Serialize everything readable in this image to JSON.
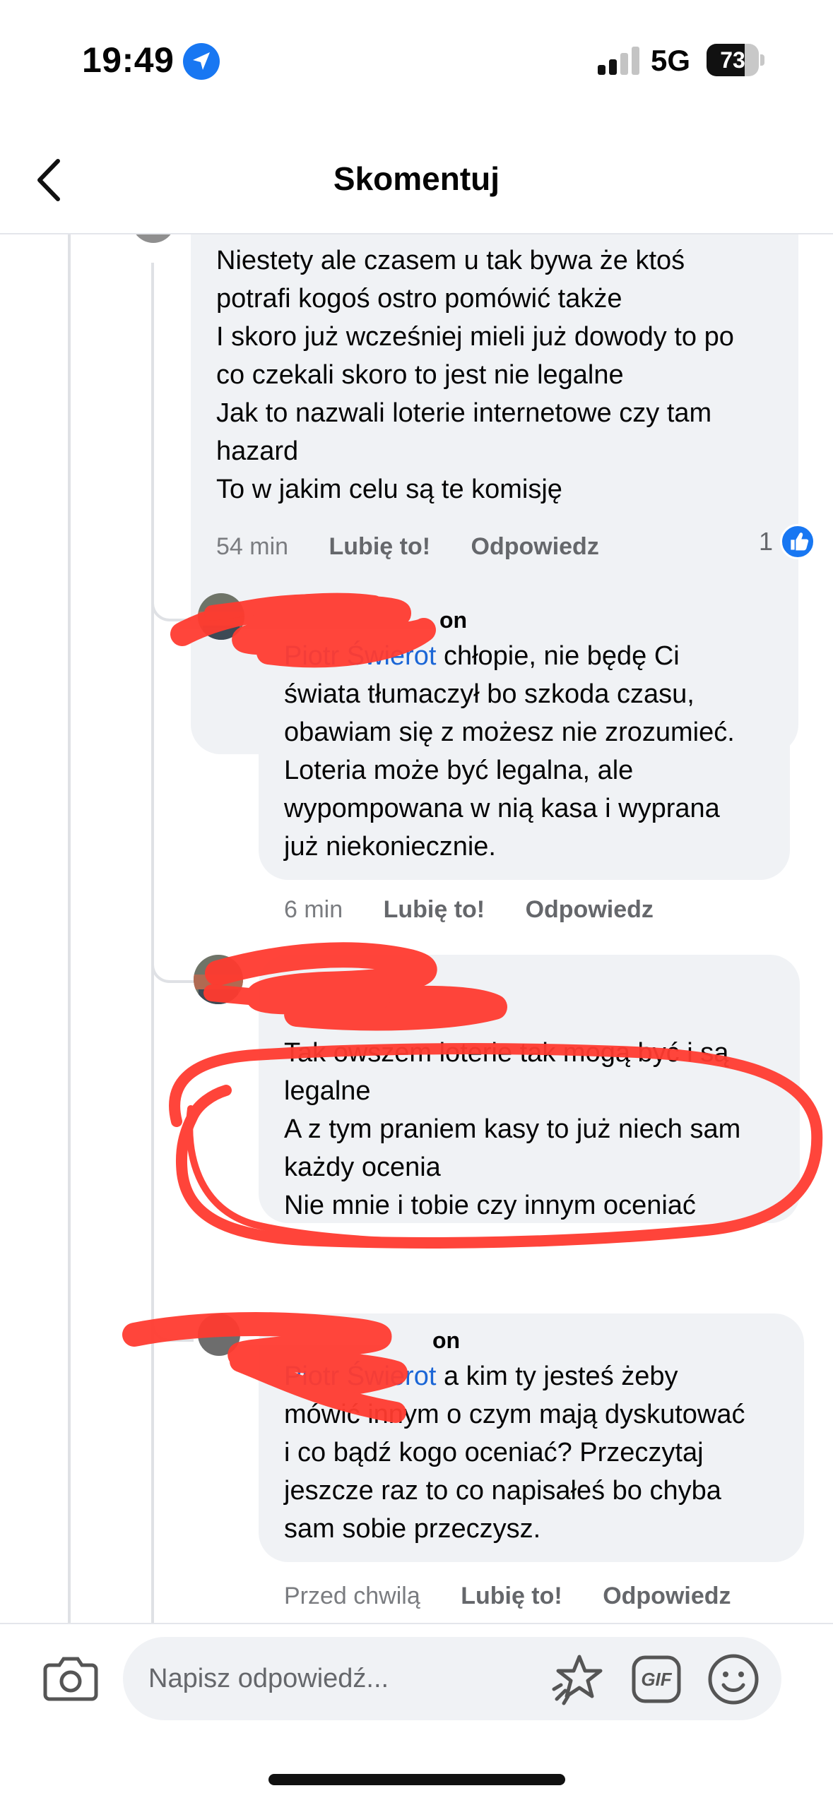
{
  "status_bar": {
    "time": "19:49",
    "network": "5G",
    "battery_level": "73",
    "battery_fraction": 0.73,
    "icons": [
      "location-arrow-icon",
      "cellular-signal-icon",
      "battery-icon"
    ]
  },
  "header": {
    "title": "Skomentuj",
    "back_icon": "chevron-left-icon"
  },
  "comments": [
    {
      "lines": [
        "Niestety ale czasem u tak bywa że ktoś",
        "potrafi kogoś ostro pomówić także",
        "I skoro już wcześniej mieli już dowody to po",
        "co czekali skoro to jest nie legalne",
        "Jak to nazwali loterie internetowe czy tam",
        "hazard",
        "To w jakim celu są te komisję"
      ],
      "time": "54 min",
      "like": "Lubię to!",
      "reply": "Odpowiedz",
      "reaction_count": "1",
      "reaction_icon": "thumbs-up-icon"
    },
    {
      "author": "on",
      "mention": "Piotr Świerot",
      "first_line_rest": " chłopie, nie będę Ci",
      "lines": [
        "świata tłumaczył bo szkoda czasu,",
        "obawiam się z możesz nie zrozumieć.",
        "Loteria może być legalna, ale",
        "wypompowana w nią kasa i wyprana",
        "już niekoniecznie."
      ],
      "time": "6 min",
      "like": "Lubię to!",
      "reply": "Odpowiedz"
    },
    {
      "lines": [
        "Tak owszem loterie tak mogą być i są",
        "legalne",
        "A z tym praniem kasy to już niech sam",
        "każdy ocenia",
        "Nie mnie i tobie czy innym oceniać"
      ]
    },
    {
      "author": "on",
      "mention": "Piotr Świerot",
      "first_line_rest": " a kim ty jesteś żeby",
      "lines": [
        "mówić innym o czym mają dyskutować",
        "i co bądź kogo oceniać? Przeczytaj",
        "jeszcze raz to co napisałeś bo chyba",
        "sam sobie przeczysz."
      ],
      "time": "Przed chwilą",
      "like": "Lubię to!",
      "reply": "Odpowiedz"
    }
  ],
  "composer": {
    "placeholder": "Napisz odpowiedź...",
    "camera_icon": "camera-icon",
    "sticker_icon": "sticker-icon",
    "gif_label": "GIF",
    "emoji_icon": "emoji-icon"
  },
  "colors": {
    "bubble": "#f0f2f5",
    "mention": "#1b66d6",
    "like_blue": "#1877f2",
    "scribble_red": "#ff3b30"
  }
}
